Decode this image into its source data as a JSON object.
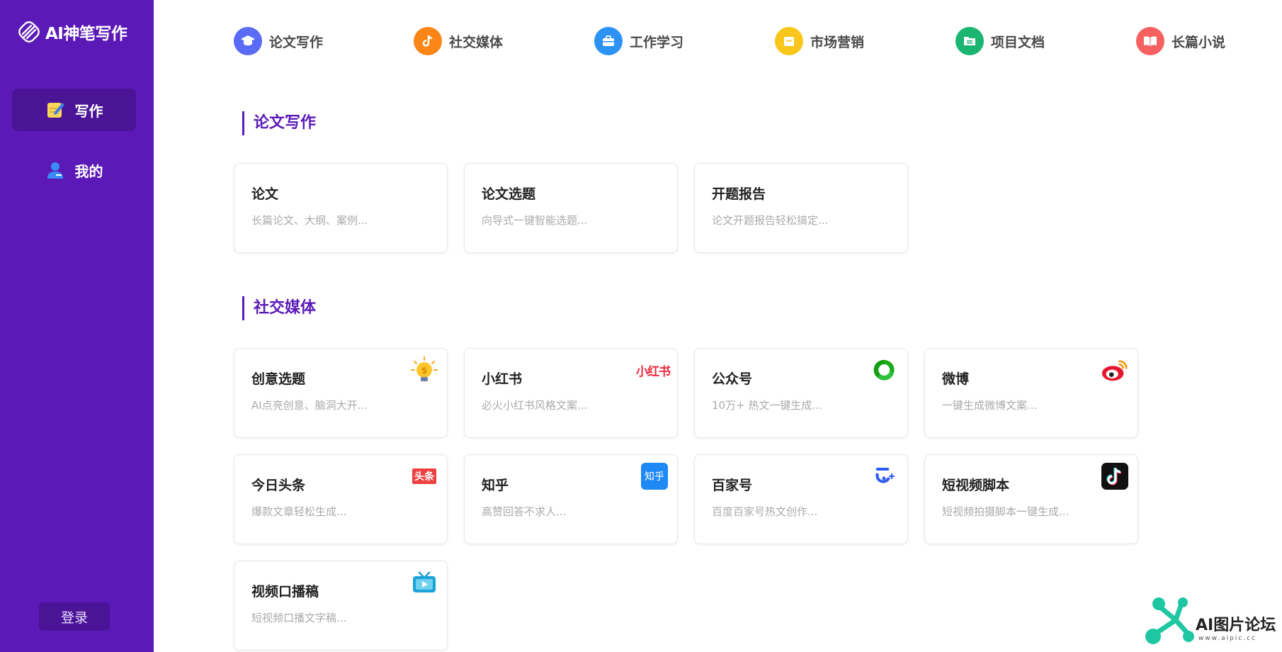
{
  "sidebar": {
    "brand_title": "AI神笔写作",
    "nav": [
      {
        "label": "写作"
      },
      {
        "label": "我的"
      }
    ],
    "login_label": "登录"
  },
  "categories": [
    {
      "label": "论文写作",
      "color": "#5a6cf5",
      "icon": "graduation-cap-icon"
    },
    {
      "label": "社交媒体",
      "color": "#fb8516",
      "icon": "tiktok-note-icon"
    },
    {
      "label": "工作学习",
      "color": "#2c93f5",
      "icon": "briefcase-icon"
    },
    {
      "label": "市场营销",
      "color": "#f9c61b",
      "icon": "shopping-bag-icon"
    },
    {
      "label": "项目文档",
      "color": "#19b571",
      "icon": "folder-icon"
    },
    {
      "label": "长篇小说",
      "color": "#f56160",
      "icon": "open-book-icon"
    }
  ],
  "sections": [
    {
      "title": "论文写作",
      "cards": [
        {
          "title": "论文",
          "desc": "长篇论文、大纲、案例..."
        },
        {
          "title": "论文选题",
          "desc": "向导式一键智能选题..."
        },
        {
          "title": "开题报告",
          "desc": "论文开题报告轻松搞定..."
        }
      ]
    },
    {
      "title": "社交媒体",
      "cards": [
        {
          "title": "创意选题",
          "desc": "AI点亮创意、脑洞大开...",
          "badge": "lightbulb-icon"
        },
        {
          "title": "小红书",
          "desc": "必火小红书风格文案...",
          "badge": "xiaohongshu-logo-icon",
          "badge_text": "小红书"
        },
        {
          "title": "公众号",
          "desc": "10万+ 热文一键生成...",
          "badge": "wechat-mp-logo-icon"
        },
        {
          "title": "微博",
          "desc": "一键生成微博文案...",
          "badge": "weibo-logo-icon"
        },
        {
          "title": "今日头条",
          "desc": "爆款文章轻松生成...",
          "badge": "toutiao-logo-icon",
          "badge_text": "头条"
        },
        {
          "title": "知乎",
          "desc": "高赞回答不求人...",
          "badge": "zhihu-logo-icon",
          "badge_text": "知乎"
        },
        {
          "title": "百家号",
          "desc": "百度百家号热文创作...",
          "badge": "baijiahao-logo-icon"
        },
        {
          "title": "短视频脚本",
          "desc": "短视频拍摄脚本一键生成...",
          "badge": "douyin-logo-icon"
        },
        {
          "title": "视频口播稿",
          "desc": "短视频口播文字稿...",
          "badge": "tv-play-icon"
        }
      ]
    }
  ],
  "watermark": {
    "title": "AI图片论坛",
    "subtitle": "www.aipic.cc"
  }
}
